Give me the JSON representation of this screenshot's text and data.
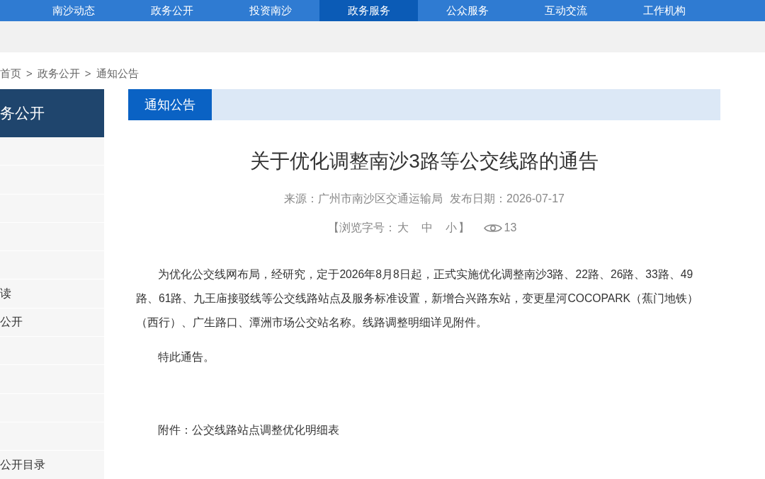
{
  "nav": {
    "items": [
      {
        "label": "南沙动态",
        "selected": false
      },
      {
        "label": "政务公开",
        "selected": false
      },
      {
        "label": "投资南沙",
        "selected": false
      },
      {
        "label": "政务服务",
        "selected": true
      },
      {
        "label": "公众服务",
        "selected": false
      },
      {
        "label": "互动交流",
        "selected": false
      },
      {
        "label": "工作机构",
        "selected": false
      }
    ]
  },
  "breadcrumb": {
    "items": [
      "首页",
      "政务公开",
      "通知公告"
    ],
    "separators": [
      ">",
      ">"
    ]
  },
  "sidebar": {
    "title": "务公开",
    "items": [
      {
        "kind": "blank"
      },
      {
        "kind": "blank"
      },
      {
        "kind": "blank"
      },
      {
        "kind": "blank"
      },
      {
        "kind": "blank"
      },
      {
        "kind": "link",
        "label": "读"
      },
      {
        "kind": "link",
        "label": "公开"
      },
      {
        "kind": "blank"
      },
      {
        "kind": "blank"
      },
      {
        "kind": "blank"
      },
      {
        "kind": "blank"
      },
      {
        "kind": "link",
        "label": "公开目录"
      }
    ]
  },
  "article": {
    "section": "通知公告",
    "title": "关于优化调整南沙3路等公交线路的通告",
    "source": "来源：广州市南沙区交通运输局",
    "date": "发布日期：2026-07-17",
    "font_size": {
      "label": "【浏览字号：",
      "options": [
        "大",
        "中",
        "小"
      ],
      "close": "】"
    },
    "views": "13",
    "paragraphs": [
      "为优化公交线网布局，经研究，定于2026年8月8日起，正式实施优化调整南沙3路、22路、26路、33路、49路、61路、九王庙接驳线等公交线路站点及服务标准设置，新增合兴路东站，变更星河COCOPARK（蕉门地铁）（西行）、广生路口、潭洲市场公交站名称。线路调整明细详见附件。",
      "特此通告。",
      "附件：公交线路站点调整优化明细表"
    ]
  }
}
